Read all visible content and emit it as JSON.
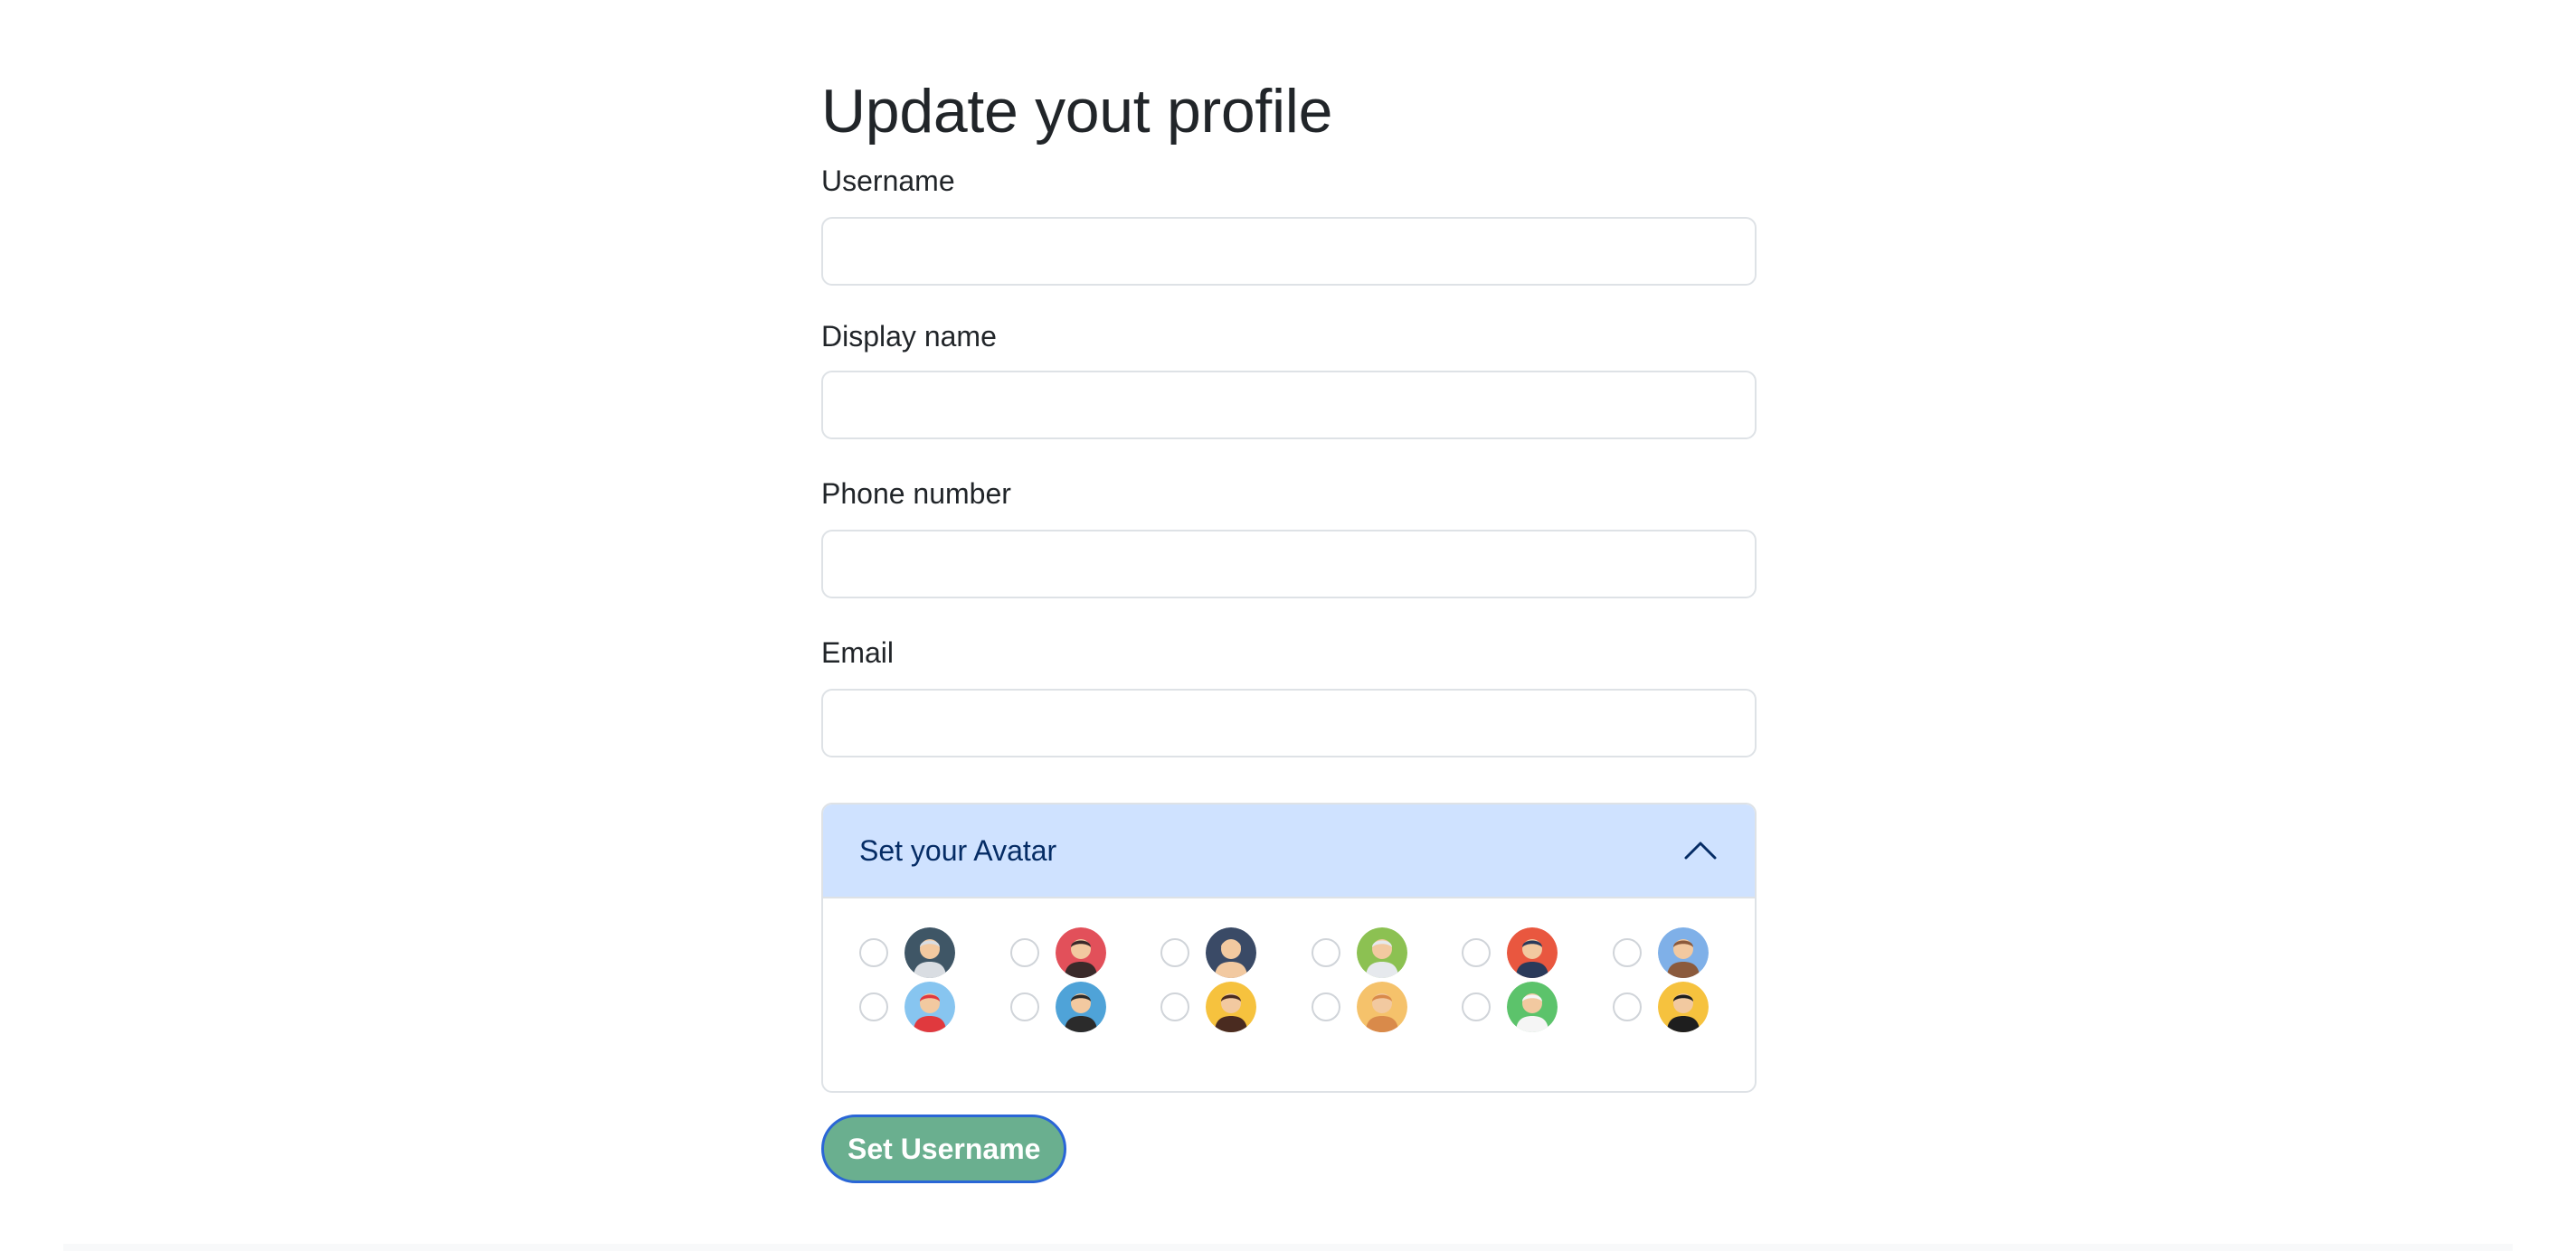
{
  "page": {
    "title": "Update yout profile"
  },
  "form": {
    "username": {
      "label": "Username",
      "value": "",
      "placeholder": ""
    },
    "display_name": {
      "label": "Display name",
      "value": "",
      "placeholder": ""
    },
    "phone": {
      "label": "Phone number",
      "value": "",
      "placeholder": ""
    },
    "email": {
      "label": "Email",
      "value": "",
      "placeholder": ""
    }
  },
  "avatar_panel": {
    "title": "Set your Avatar",
    "expanded": true,
    "icon": "chevron-up-icon",
    "options": [
      {
        "name": "astronaut",
        "bg": "#3f5666",
        "accent": "#d9dde2"
      },
      {
        "name": "bearded-man",
        "bg": "#e2505a",
        "accent": "#3a2a2a"
      },
      {
        "name": "medic",
        "bg": "#3a4a66",
        "accent": "#f2c9a0"
      },
      {
        "name": "vr-girl",
        "bg": "#8cc152",
        "accent": "#e6e9ed"
      },
      {
        "name": "dark-hair-man",
        "bg": "#e9573f",
        "accent": "#2a3a5a"
      },
      {
        "name": "bear",
        "bg": "#7fb0e8",
        "accent": "#8b5a3c"
      },
      {
        "name": "red-hoodie",
        "bg": "#87c5f0",
        "accent": "#e0393e"
      },
      {
        "name": "headphones",
        "bg": "#4fa3d8",
        "accent": "#2b2b2b"
      },
      {
        "name": "glasses-girl",
        "bg": "#f6c23e",
        "accent": "#4a2b20"
      },
      {
        "name": "blonde-girl",
        "bg": "#f5c26b",
        "accent": "#d98a4a"
      },
      {
        "name": "llama",
        "bg": "#5cc36b",
        "accent": "#f5f5f5"
      },
      {
        "name": "dark-haired-girl",
        "bg": "#f6c23e",
        "accent": "#1e1e1e"
      }
    ]
  },
  "submit": {
    "label": "Set Username"
  },
  "colors": {
    "accordion_header": "#cfe2ff",
    "accordion_title": "#052c65",
    "button_bg": "#6aaf8f",
    "button_border": "#2a66d6"
  }
}
